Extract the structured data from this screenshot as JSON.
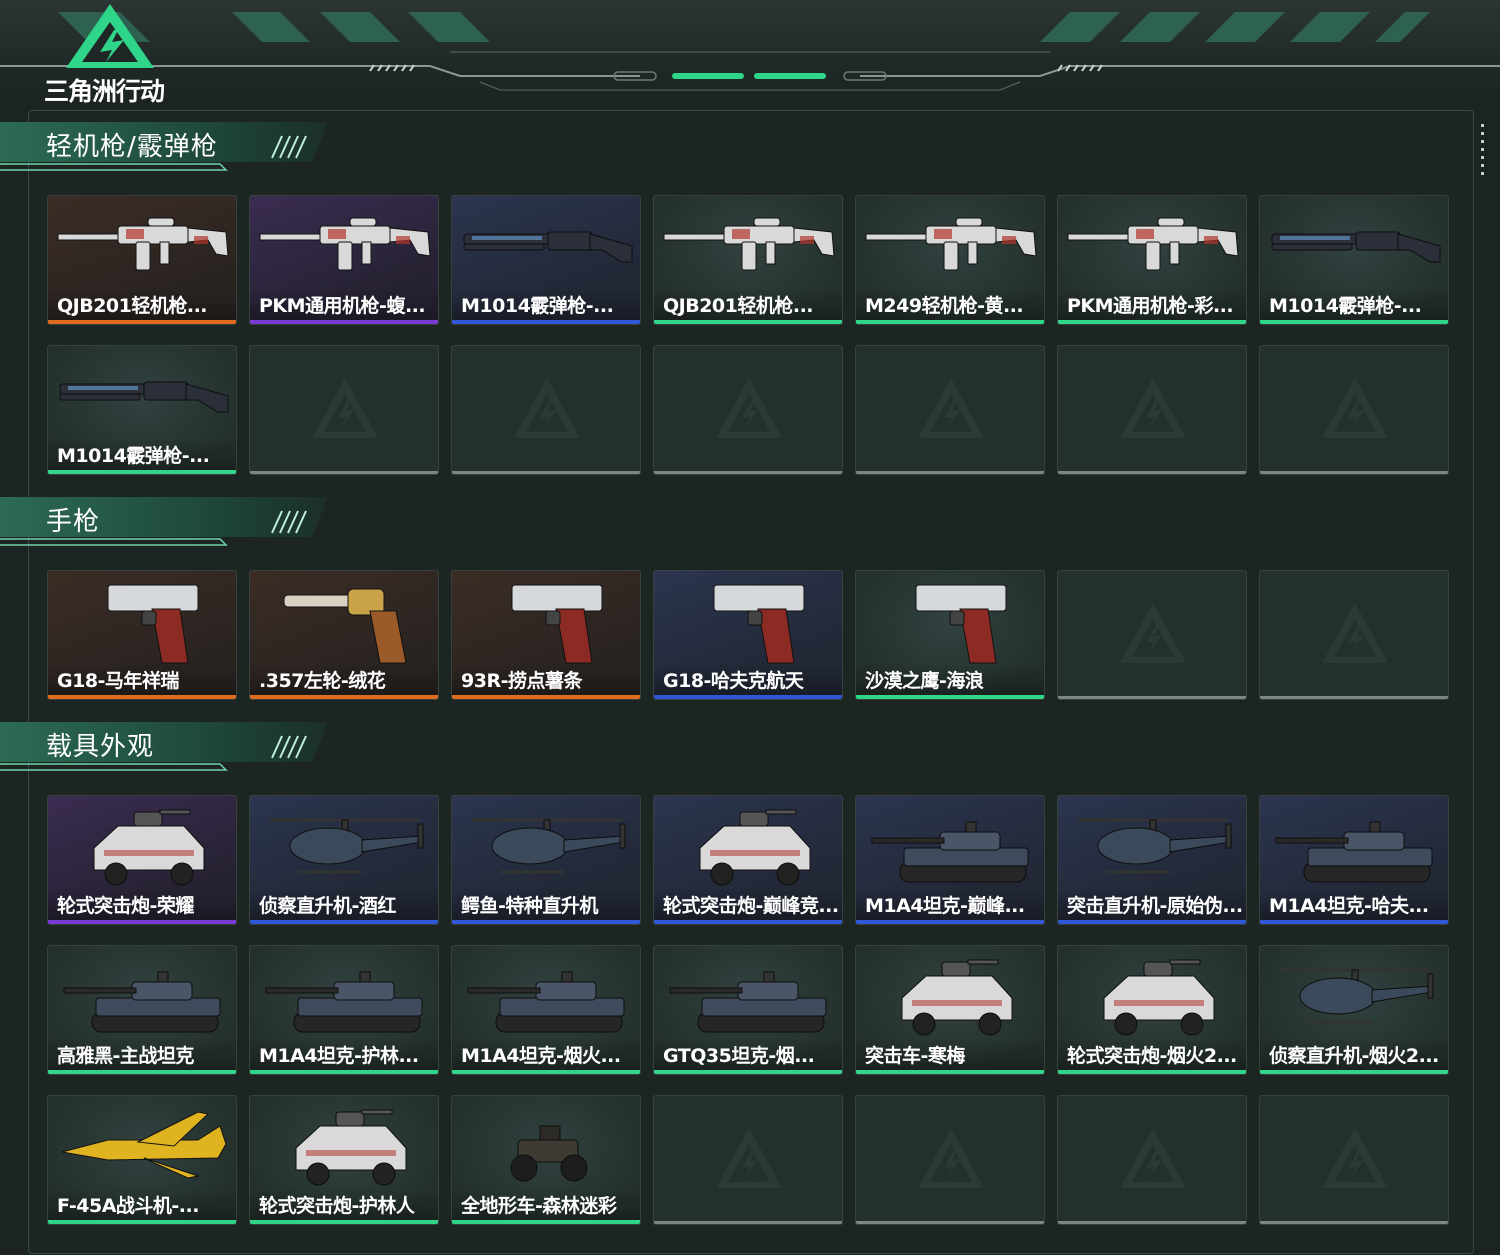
{
  "header": {
    "brand": "三角洲行动"
  },
  "colors": {
    "orange": "#e06a1e",
    "purple": "#7a3ad6",
    "blue": "#2f57d6",
    "green": "#2fd68a",
    "empty": "#7e8683"
  },
  "sections": [
    {
      "title": "轻机枪/霰弹枪",
      "cards": [
        {
          "label": "QJB201轻机枪...",
          "rarity": "orange",
          "icon": "machine-gun"
        },
        {
          "label": "PKM通用机枪-蝮...",
          "rarity": "purple",
          "icon": "machine-gun"
        },
        {
          "label": "M1014霰弹枪-...",
          "rarity": "blue",
          "icon": "shotgun"
        },
        {
          "label": "QJB201轻机枪...",
          "rarity": "green",
          "icon": "machine-gun"
        },
        {
          "label": "M249轻机枪-黄...",
          "rarity": "green",
          "icon": "machine-gun"
        },
        {
          "label": "PKM通用机枪-彩...",
          "rarity": "green",
          "icon": "machine-gun"
        },
        {
          "label": "M1014霰弹枪-...",
          "rarity": "green",
          "icon": "shotgun"
        },
        {
          "label": "M1014霰弹枪-...",
          "rarity": "green",
          "icon": "shotgun"
        },
        null,
        null,
        null,
        null,
        null,
        null
      ]
    },
    {
      "title": "手枪",
      "cards": [
        {
          "label": "G18-马年祥瑞",
          "rarity": "orange",
          "icon": "pistol"
        },
        {
          "label": ".357左轮-绒花",
          "rarity": "orange",
          "icon": "revolver"
        },
        {
          "label": "93R-捞点薯条",
          "rarity": "orange",
          "icon": "pistol"
        },
        {
          "label": "G18-哈夫克航天",
          "rarity": "blue",
          "icon": "pistol"
        },
        {
          "label": "沙漠之鹰-海浪",
          "rarity": "green",
          "icon": "pistol"
        },
        null,
        null
      ]
    },
    {
      "title": "载具外观",
      "cards": [
        {
          "label": "轮式突击炮-荣耀",
          "rarity": "purple",
          "icon": "armored-car"
        },
        {
          "label": "侦察直升机-酒红",
          "rarity": "blue",
          "icon": "helicopter"
        },
        {
          "label": "鳄鱼-特种直升机",
          "rarity": "blue",
          "icon": "helicopter"
        },
        {
          "label": "轮式突击炮-巅峰竞...",
          "rarity": "blue",
          "icon": "armored-car"
        },
        {
          "label": "M1A4坦克-巅峰...",
          "rarity": "blue",
          "icon": "tank"
        },
        {
          "label": "突击直升机-原始伪...",
          "rarity": "blue",
          "icon": "helicopter"
        },
        {
          "label": "M1A4坦克-哈夫...",
          "rarity": "blue",
          "icon": "tank"
        },
        {
          "label": "高雅黑-主战坦克",
          "rarity": "green",
          "icon": "tank"
        },
        {
          "label": "M1A4坦克-护林...",
          "rarity": "green",
          "icon": "tank"
        },
        {
          "label": "M1A4坦克-烟火...",
          "rarity": "green",
          "icon": "tank"
        },
        {
          "label": "GTQ35坦克-烟...",
          "rarity": "green",
          "icon": "tank"
        },
        {
          "label": "突击车-寒梅",
          "rarity": "green",
          "icon": "armored-car"
        },
        {
          "label": "轮式突击炮-烟火2...",
          "rarity": "green",
          "icon": "armored-car"
        },
        {
          "label": "侦察直升机-烟火2...",
          "rarity": "green",
          "icon": "helicopter"
        },
        {
          "label": "F-45A战斗机-...",
          "rarity": "green",
          "icon": "jet"
        },
        {
          "label": "轮式突击炮-护林人",
          "rarity": "green",
          "icon": "armored-car"
        },
        {
          "label": "全地形车-森林迷彩",
          "rarity": "green",
          "icon": "atv"
        },
        null,
        null,
        null,
        null
      ]
    }
  ]
}
